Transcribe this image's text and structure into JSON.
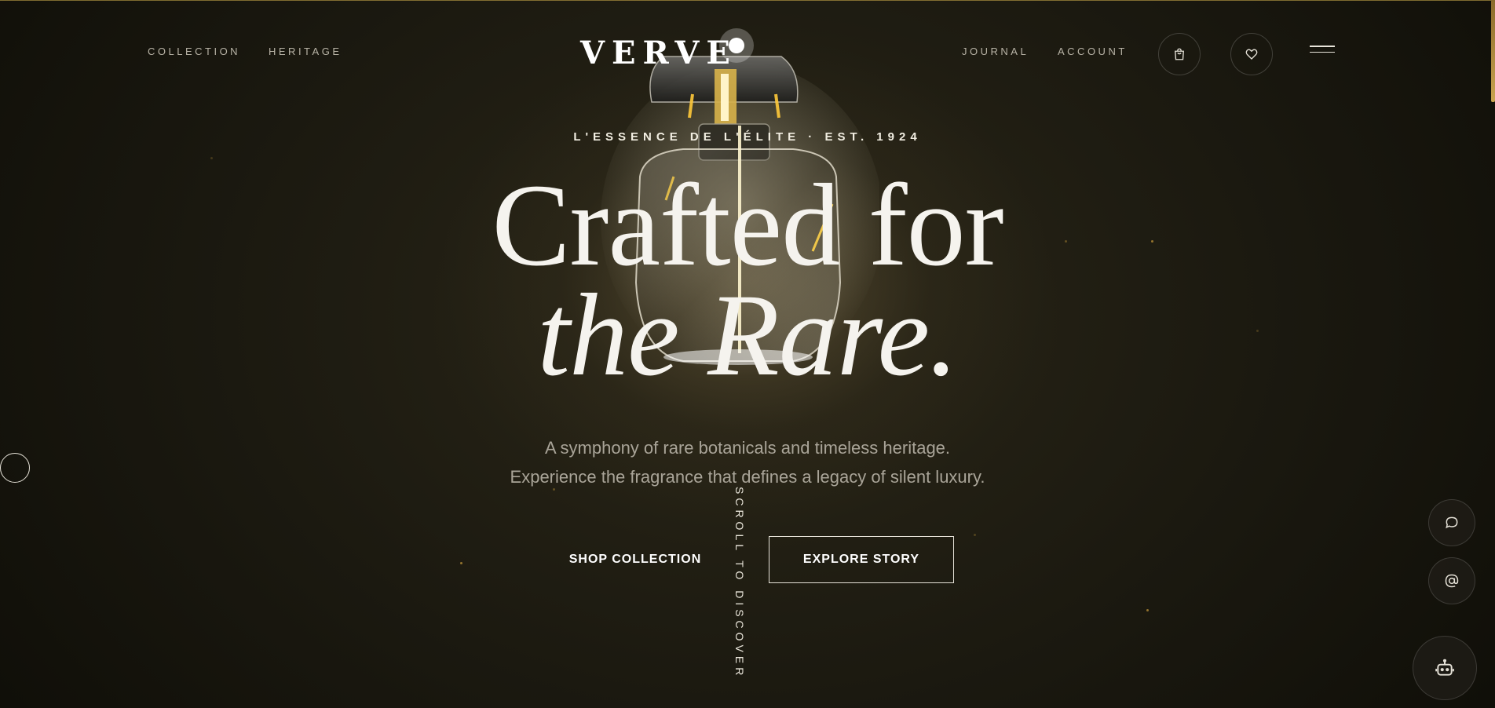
{
  "nav": {
    "left_links": [
      "COLLECTION",
      "HERITAGE"
    ],
    "brand": "VERVE",
    "right_links": [
      "JOURNAL",
      "ACCOUNT"
    ],
    "icons": [
      "bag-icon",
      "heart-icon",
      "menu-icon"
    ]
  },
  "hero": {
    "eyebrow": "L'ESSENCE DE L'ÉLITE · EST. 1924",
    "headline_line1": "Crafted for",
    "headline_line2": "the Rare.",
    "subtitle_line1": "A symphony of rare botanicals and timeless heritage.",
    "subtitle_line2": "Experience the fragrance that defines a legacy of silent luxury.",
    "primary_cta": "SHOP COLLECTION",
    "secondary_cta": "EXPLORE STORY",
    "scroll_hint": "SCROLL TO DISCOVER"
  },
  "floating_actions": [
    "chat-icon",
    "at-sign-icon",
    "robot-icon"
  ],
  "colors": {
    "background": "#1b1910",
    "accent_gold": "#c8a84a",
    "text_primary": "#f5f3ee",
    "text_muted": "#a9a498"
  }
}
